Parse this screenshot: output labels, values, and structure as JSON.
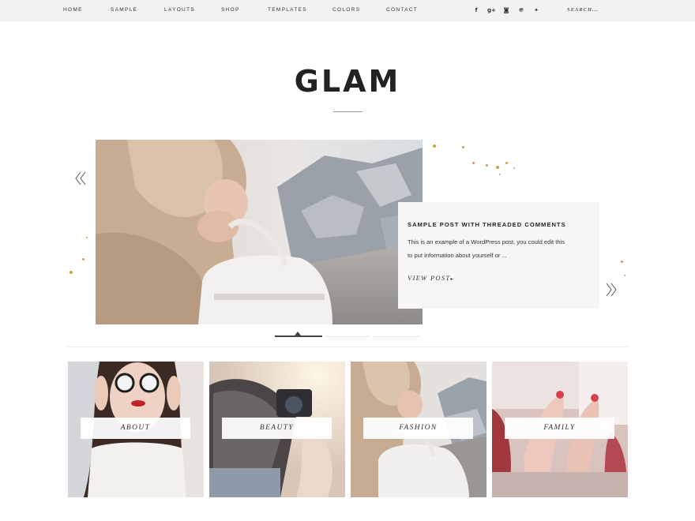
{
  "nav": {
    "items": [
      "HOME",
      "SAMPLE",
      "LAYOUTS",
      "SHOP",
      "TEMPLATES",
      "COLORS",
      "CONTACT"
    ],
    "social_icons": [
      "facebook-icon",
      "google-plus-icon",
      "instagram-icon",
      "pinterest-icon",
      "twitter-icon"
    ],
    "social_glyphs": [
      "f",
      "g+",
      "◙",
      "℗",
      "✦"
    ],
    "search_label": "SEARCH..."
  },
  "site": {
    "title": "GLAM"
  },
  "slider": {
    "post_title": "SAMPLE POST WITH THREADED COMMENTS",
    "excerpt_line1": "This is an example of a WordPress post, you could edit this",
    "excerpt_line2": "to put information about yourself or ...",
    "link_label": "VIEW POST",
    "link_arrow": "▸",
    "slide_count": 3,
    "active_slide": 1
  },
  "tiles": [
    {
      "label": "ABOUT"
    },
    {
      "label": "BEAUTY"
    },
    {
      "label": "FASHION"
    },
    {
      "label": "FAMILY"
    }
  ],
  "colors": {
    "topbar": "#f0f2f3",
    "accent_gold": "#c9a24a",
    "caption_bg": "#f6f6f6"
  }
}
